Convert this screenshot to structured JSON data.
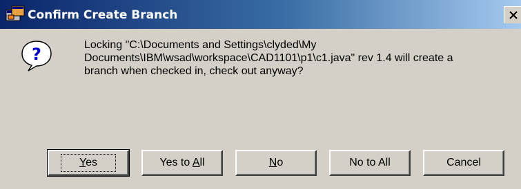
{
  "window": {
    "title": "Confirm Create Branch"
  },
  "icons": {
    "app": "app-window-icon",
    "close": "close-icon",
    "question": "question-icon"
  },
  "message": "Locking \"C:\\Documents and Settings\\clyded\\My\nDocuments\\IBM\\wsad\\workspace\\CAD1101\\p1\\c1.java\" rev 1.4 will create a\nbranch when checked in, check out anyway?",
  "buttons": [
    {
      "pre": "",
      "mn": "Y",
      "post": "es"
    },
    {
      "pre": "Yes to ",
      "mn": "A",
      "post": "ll"
    },
    {
      "pre": "",
      "mn": "N",
      "post": "o"
    },
    {
      "pre": "No to All",
      "mn": "",
      "post": ""
    },
    {
      "pre": "Cancel",
      "mn": "",
      "post": ""
    }
  ],
  "colors": {
    "title_start": "#0a246a",
    "title_end": "#a6caf0",
    "face": "#d4d0c8",
    "question_mark": "#0000cc"
  }
}
